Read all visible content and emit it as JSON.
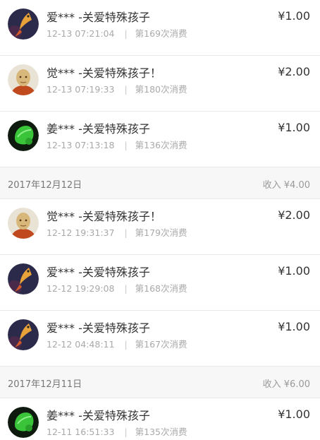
{
  "sections": [
    {
      "header": null,
      "rows": [
        {
          "avatar": "koi-fish-avatar",
          "title": "爱*** -关爱特殊孩子",
          "time": "12-13 07:21:04",
          "count": "第169次消费",
          "amount": "¥1.00"
        },
        {
          "avatar": "monk-avatar",
          "title": "觉*** -关爱特殊孩子！",
          "time": "12-13 07:19:33",
          "count": "第180次消费",
          "amount": "¥2.00"
        },
        {
          "avatar": "green-leaf-avatar",
          "title": "姜*** -关爱特殊孩子",
          "time": "12-13 07:13:18",
          "count": "第136次消费",
          "amount": "¥1.00"
        }
      ]
    },
    {
      "header": {
        "date": "2017年12月12日",
        "income": "收入 ¥4.00"
      },
      "rows": [
        {
          "avatar": "monk-avatar",
          "title": "觉*** -关爱特殊孩子！",
          "time": "12-12 19:31:37",
          "count": "第179次消费",
          "amount": "¥2.00"
        },
        {
          "avatar": "koi-fish-avatar",
          "title": "爱*** -关爱特殊孩子",
          "time": "12-12 19:29:08",
          "count": "第168次消费",
          "amount": "¥1.00"
        },
        {
          "avatar": "koi-fish-avatar",
          "title": "爱*** -关爱特殊孩子",
          "time": "12-12 04:48:11",
          "count": "第167次消费",
          "amount": "¥1.00"
        }
      ]
    },
    {
      "header": {
        "date": "2017年12月11日",
        "income": "收入 ¥6.00"
      },
      "rows": [
        {
          "avatar": "green-leaf-avatar",
          "title": "姜*** -关爱特殊孩子",
          "time": "12-11 16:51:33",
          "count": "第135次消费",
          "amount": "¥1.00"
        }
      ]
    }
  ],
  "separator": "|",
  "colors": {
    "text_primary": "#333333",
    "text_secondary": "#a9a9a9",
    "header_bg": "#f7f7f7",
    "divider": "#e9e9e9"
  }
}
